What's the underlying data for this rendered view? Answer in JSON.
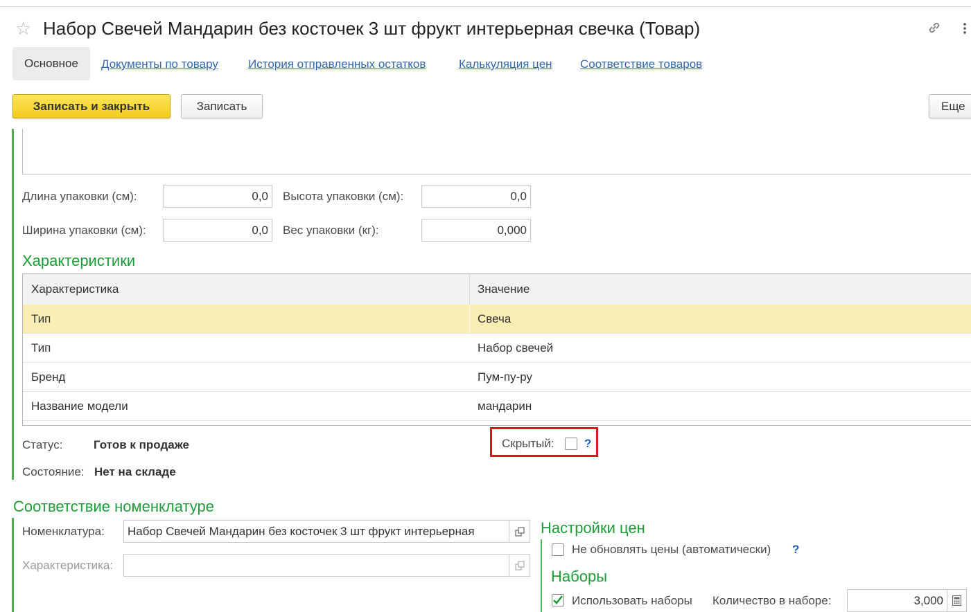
{
  "window": {
    "title": "Набор Свечей Мандарин без косточек 3 шт фрукт интерьерная свечка (Товар)"
  },
  "tabs": [
    {
      "label": "Основное"
    },
    {
      "label": "Документы по товару"
    },
    {
      "label": "История отправленных остатков"
    },
    {
      "label": "Калькуляция цен"
    },
    {
      "label": "Соответствие товаров"
    }
  ],
  "toolbar": {
    "save_close_label": "Записать и закрыть",
    "save_label": "Записать",
    "more_label": "Еще"
  },
  "package": {
    "length_label": "Длина упаковки (см):",
    "length_value": "0,0",
    "height_label": "Высота упаковки (см):",
    "height_value": "0,0",
    "width_label": "Ширина упаковки (см):",
    "width_value": "0,0",
    "weight_label": "Вес упаковки (кг):",
    "weight_value": "0,000"
  },
  "characteristics": {
    "section_title": "Характеристики",
    "col_name": "Характеристика",
    "col_value": "Значение",
    "rows": [
      {
        "name": "Тип",
        "value": "Свеча"
      },
      {
        "name": "Тип",
        "value": "Набор свечей"
      },
      {
        "name": "Бренд",
        "value": "Пум-пу-ру"
      },
      {
        "name": "Название модели",
        "value": "мандарин"
      }
    ]
  },
  "status": {
    "status_label": "Статус:",
    "status_value": "Готов к продаже",
    "state_label": "Состояние:",
    "state_value": "Нет на складе",
    "hidden_label": "Скрытый:",
    "hidden_checked": false,
    "help": "?"
  },
  "nomenclature": {
    "section_title": "Соответствие номенклатуре",
    "nom_label": "Номенклатура:",
    "nom_value": "Набор Свечей Мандарин без косточек 3 шт фрукт интерьерная",
    "char_label": "Характеристика:",
    "char_value": ""
  },
  "prices": {
    "section_title": "Настройки цен",
    "no_update_label": "Не обновлять цены (автоматически)",
    "no_update_checked": false,
    "help": "?"
  },
  "sets": {
    "section_title": "Наборы",
    "use_sets_label": "Использовать наборы",
    "use_sets_checked": true,
    "qty_label": "Количество в наборе:",
    "qty_value": "3,000"
  },
  "colors": {
    "accent_green": "#1e9c3a",
    "link_blue": "#3366b2",
    "primary_yellow": "#f5d327",
    "selected_row": "#fbeeb5",
    "highlight_red": "#e0141c"
  }
}
